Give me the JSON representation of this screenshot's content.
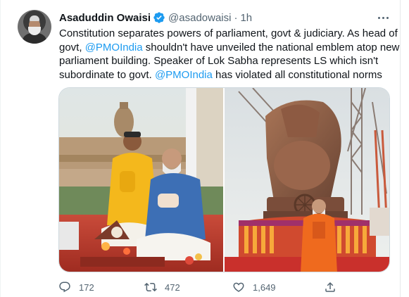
{
  "tweet": {
    "author_name": "Asaduddin Owaisi",
    "handle": "@asadowaisi",
    "separator": "·",
    "timestamp": "1h",
    "text_lines": [
      [
        "Constitution separates powers of parliament, govt & judiciary. As head of"
      ],
      [
        "govt, ",
        "@PMOIndia",
        " shouldn't have unveiled the national emblem atop new"
      ],
      [
        "parliament building. Speaker of Lok Sabha represents LS which isn't"
      ],
      [
        "subordinate to govt. ",
        "@PMOIndia",
        " has violated all constitutional norms"
      ]
    ]
  },
  "actions": {
    "reply_count": "172",
    "retweet_count": "472",
    "like_count": "1,649"
  },
  "colors": {
    "link": "#1d9bf0",
    "verified": "#1d9bf0",
    "muted": "#536471",
    "text": "#0f1419"
  },
  "icons": {
    "verified": "verified-badge-icon",
    "more": "more-options-icon",
    "reply": "reply-icon",
    "retweet": "retweet-icon",
    "like": "like-icon",
    "share": "share-icon"
  }
}
